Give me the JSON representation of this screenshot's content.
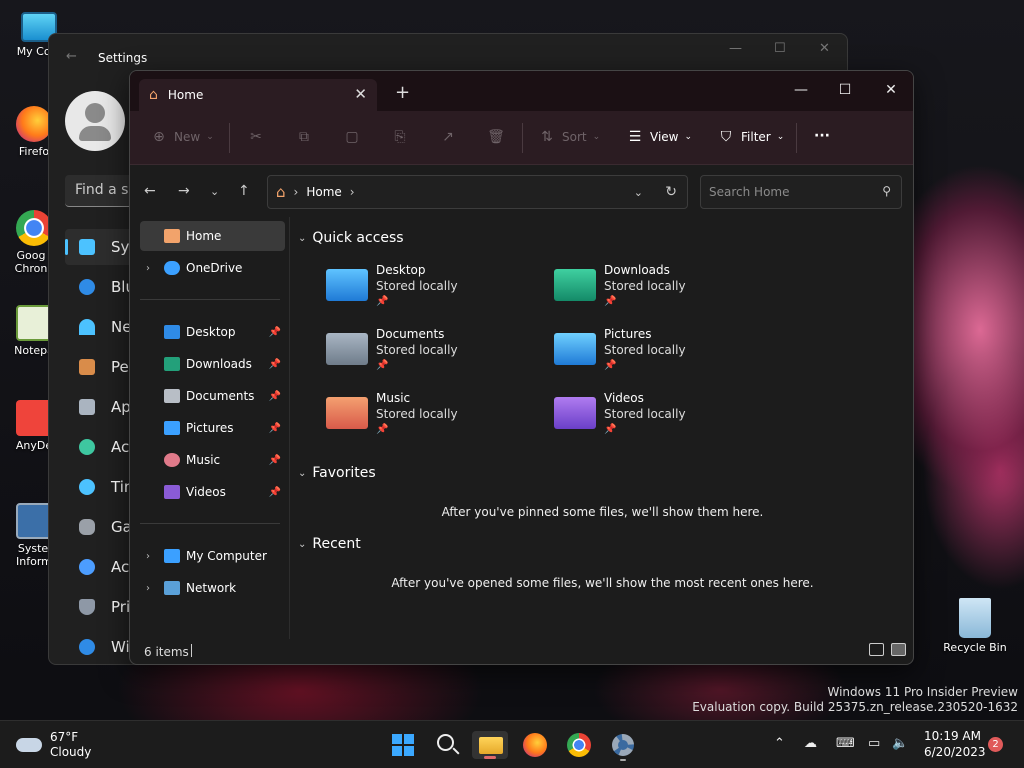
{
  "desktop": {
    "icons": [
      "My Com",
      "Firefo",
      "Goog Chron",
      "Notepa",
      "AnyDe",
      "Syste Inform"
    ],
    "recycle_bin": "Recycle Bin",
    "watermark_line1": "Windows 11 Pro Insider Preview",
    "watermark_line2": "Evaluation copy. Build 25375.zn_release.230520-1632"
  },
  "settings": {
    "title": "Settings",
    "search_placeholder": "Find a se",
    "nav": [
      "Syst",
      "Blue",
      "Net",
      "Pers",
      "App",
      "Acc",
      "Tim",
      "Gan",
      "Acc",
      "Priv",
      "Win"
    ]
  },
  "explorer": {
    "tab_title": "Home",
    "new_tab": "+",
    "toolbar": {
      "new": "New",
      "sort": "Sort",
      "view": "View",
      "filter": "Filter",
      "more": "···"
    },
    "address": {
      "location": "Home"
    },
    "search_placeholder": "Search Home",
    "nav_pane": {
      "top": [
        "Home",
        "OneDrive"
      ],
      "pinned": [
        "Desktop",
        "Downloads",
        "Documents",
        "Pictures",
        "Music",
        "Videos"
      ],
      "bottom": [
        "My Computer",
        "Network"
      ]
    },
    "sections": {
      "quick_access": "Quick access",
      "favorites": "Favorites",
      "recent": "Recent"
    },
    "quick_access": [
      {
        "name": "Desktop",
        "status": "Stored locally",
        "icon": "desktop-folder-icon",
        "color": "#2f8be6"
      },
      {
        "name": "Downloads",
        "status": "Stored locally",
        "icon": "downloads-folder-icon",
        "color": "#23a07a"
      },
      {
        "name": "Documents",
        "status": "Stored locally",
        "icon": "documents-folder-icon",
        "color": "#7f8b99"
      },
      {
        "name": "Pictures",
        "status": "Stored locally",
        "icon": "pictures-folder-icon",
        "color": "#2f8be6"
      },
      {
        "name": "Music",
        "status": "Stored locally",
        "icon": "music-folder-icon",
        "color": "#e07a52"
      },
      {
        "name": "Videos",
        "status": "Stored locally",
        "icon": "videos-folder-icon",
        "color": "#8a5bd6"
      }
    ],
    "favorites_empty": "After you've pinned some files, we'll show them here.",
    "recent_empty": "After you've opened some files, we'll show the most recent ones here.",
    "status": {
      "items": "6 items"
    }
  },
  "taskbar": {
    "weather_temp": "67°F",
    "weather_desc": "Cloudy",
    "time": "10:19 AM",
    "date": "6/20/2023",
    "notification_count": "2"
  }
}
